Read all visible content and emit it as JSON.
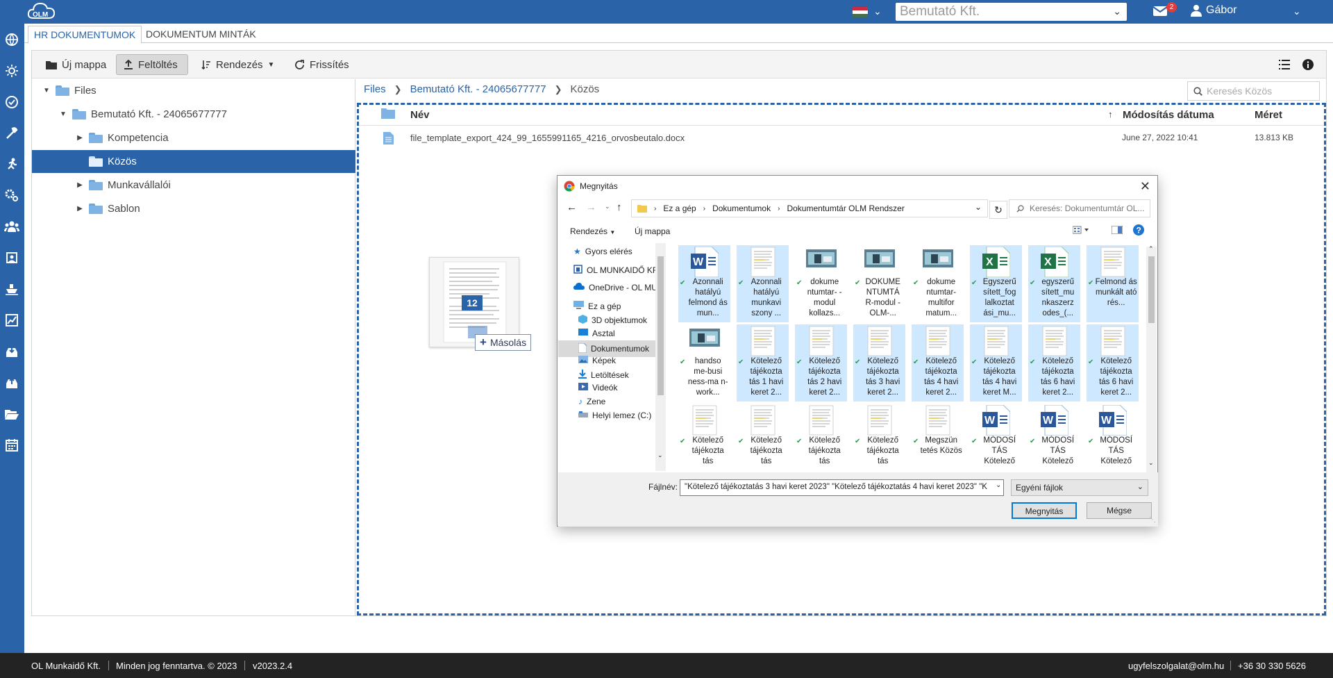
{
  "app": {
    "logo_text": "OLM"
  },
  "topbar": {
    "company": "Bemutató Kft.",
    "mail_badge": "2",
    "user_name": "Gábor"
  },
  "tabs": [
    {
      "label": "HR DOKUMENTUMOK"
    },
    {
      "label": "DOKUMENTUM MINTÁK"
    }
  ],
  "toolbar": {
    "new_folder": "Új mappa",
    "upload": "Feltöltés",
    "sort": "Rendezés",
    "refresh": "Frissítés"
  },
  "tree": {
    "root": "Files",
    "company": "Bemutató Kft. - 24065677777",
    "children": [
      "Kompetencia",
      "Közös",
      "Munkavállalói",
      "Sablon"
    ],
    "selected": "Közös"
  },
  "breadcrumb": [
    "Files",
    "Bemutató Kft. - 24065677777",
    "Közös"
  ],
  "search": {
    "placeholder": "Keresés Közös"
  },
  "file_table": {
    "columns": {
      "name": "Név",
      "modified": "Módosítás dátuma",
      "size": "Méret"
    },
    "rows": [
      {
        "name": "file_template_export_424_99_1655991165_4216_orvosbeutalo.docx",
        "modified": "June 27, 2022 10:41",
        "size": "13.813 KB"
      }
    ]
  },
  "drag": {
    "count": "12",
    "tooltip": "Másolás"
  },
  "dialog": {
    "title": "Megnyitás",
    "path": [
      "Ez a gép",
      "Dokumentumok",
      "Dokumentumtár OLM Rendszer"
    ],
    "search_placeholder": "Keresés: Dokumentumtár OL...",
    "organize": "Rendezés",
    "new_folder": "Új mappa",
    "nav": [
      "Gyors elérés",
      "OL MUNKAIDŐ KF",
      "OneDrive - OL MU",
      "Ez a gép",
      "3D objektumok",
      "Asztal",
      "Dokumentumok",
      "Képek",
      "Letöltések",
      "Videók",
      "Zene",
      "Helyi lemez (C:)"
    ],
    "files": [
      {
        "name": "Azonnali hatályú felmond ás mun...",
        "icon": "word-icon",
        "selected": true
      },
      {
        "name": "Azonnali hatályú munkavi szony ...",
        "icon": "doc-preview-icon",
        "selected": true
      },
      {
        "name": "dokume ntumtar- -modul kollazs...",
        "icon": "image-icon",
        "selected": false
      },
      {
        "name": "DOKUME NTUMTÁ R-modul -OLM-...",
        "icon": "image-icon",
        "selected": false
      },
      {
        "name": "dokume ntumtar- multifor matum...",
        "icon": "image-icon",
        "selected": false
      },
      {
        "name": "Egyszerű sített_fog lalkoztat ási_mu...",
        "icon": "excel-icon",
        "selected": true
      },
      {
        "name": "egyszerű sített_mu nkaszerz odes_(...",
        "icon": "excel-icon",
        "selected": true
      },
      {
        "name": "Felmond ás munkált ató rés...",
        "icon": "doc-preview-icon",
        "selected": true
      },
      {
        "name": "handso me-busi ness-ma n-work...",
        "icon": "image-icon",
        "selected": false
      },
      {
        "name": "Kötelező tájékozta tás 1 havi keret 2...",
        "icon": "doc-preview-icon",
        "selected": true
      },
      {
        "name": "Kötelező tájékozta tás 2 havi keret 2...",
        "icon": "doc-preview-icon",
        "selected": true
      },
      {
        "name": "Kötelező tájékozta tás 3 havi keret 2...",
        "icon": "doc-preview-icon",
        "selected": true
      },
      {
        "name": "Kötelező tájékozta tás 4 havi keret 2...",
        "icon": "doc-preview-icon",
        "selected": true
      },
      {
        "name": "Kötelező tájékozta tás 4 havi keret M...",
        "icon": "doc-preview-icon",
        "selected": true
      },
      {
        "name": "Kötelező tájékozta tás 6 havi keret 2...",
        "icon": "doc-preview-icon",
        "selected": true
      },
      {
        "name": "Kötelező tájékozta tás 6 havi keret 2...",
        "icon": "doc-preview-icon",
        "selected": true
      },
      {
        "name": "Kötelező tájékozta tás",
        "icon": "doc-preview-icon",
        "selected": false
      },
      {
        "name": "Kötelező tájékozta tás",
        "icon": "doc-preview-icon",
        "selected": false
      },
      {
        "name": "Kötelező tájékozta tás",
        "icon": "doc-preview-icon",
        "selected": false
      },
      {
        "name": "Kötelező tájékozta tás",
        "icon": "doc-preview-icon",
        "selected": false
      },
      {
        "name": "Megszün tetés Közös",
        "icon": "doc-preview-icon",
        "selected": false
      },
      {
        "name": "MÓDOSÍ TÁS Kötelező",
        "icon": "word-icon",
        "selected": false
      },
      {
        "name": "MÓDOSÍ TÁS Kötelező",
        "icon": "word-icon",
        "selected": false
      },
      {
        "name": "MÓDOSÍ TÁS Kötelező",
        "icon": "word-icon",
        "selected": false
      }
    ],
    "filename_label": "Fájlnév:",
    "filename_value": "\"Kötelező tájékoztatás 3 havi keret  2023\" \"Kötelező tájékoztatás 4 havi keret  2023\" \"K",
    "filter": "Egyéni fájlok",
    "open_button": "Megnyitás",
    "cancel_button": "Mégse"
  },
  "footer": {
    "company": "OL Munkaidő Kft.",
    "rights": "Minden jog fenntartva. © 2023",
    "version": "v2023.2.4",
    "email": "ugyfelszolgalat@olm.hu",
    "phone": "+36 30 330 5626"
  },
  "colors": {
    "primary": "#2a63a8",
    "selection": "#cde8ff",
    "footer": "#232323"
  }
}
